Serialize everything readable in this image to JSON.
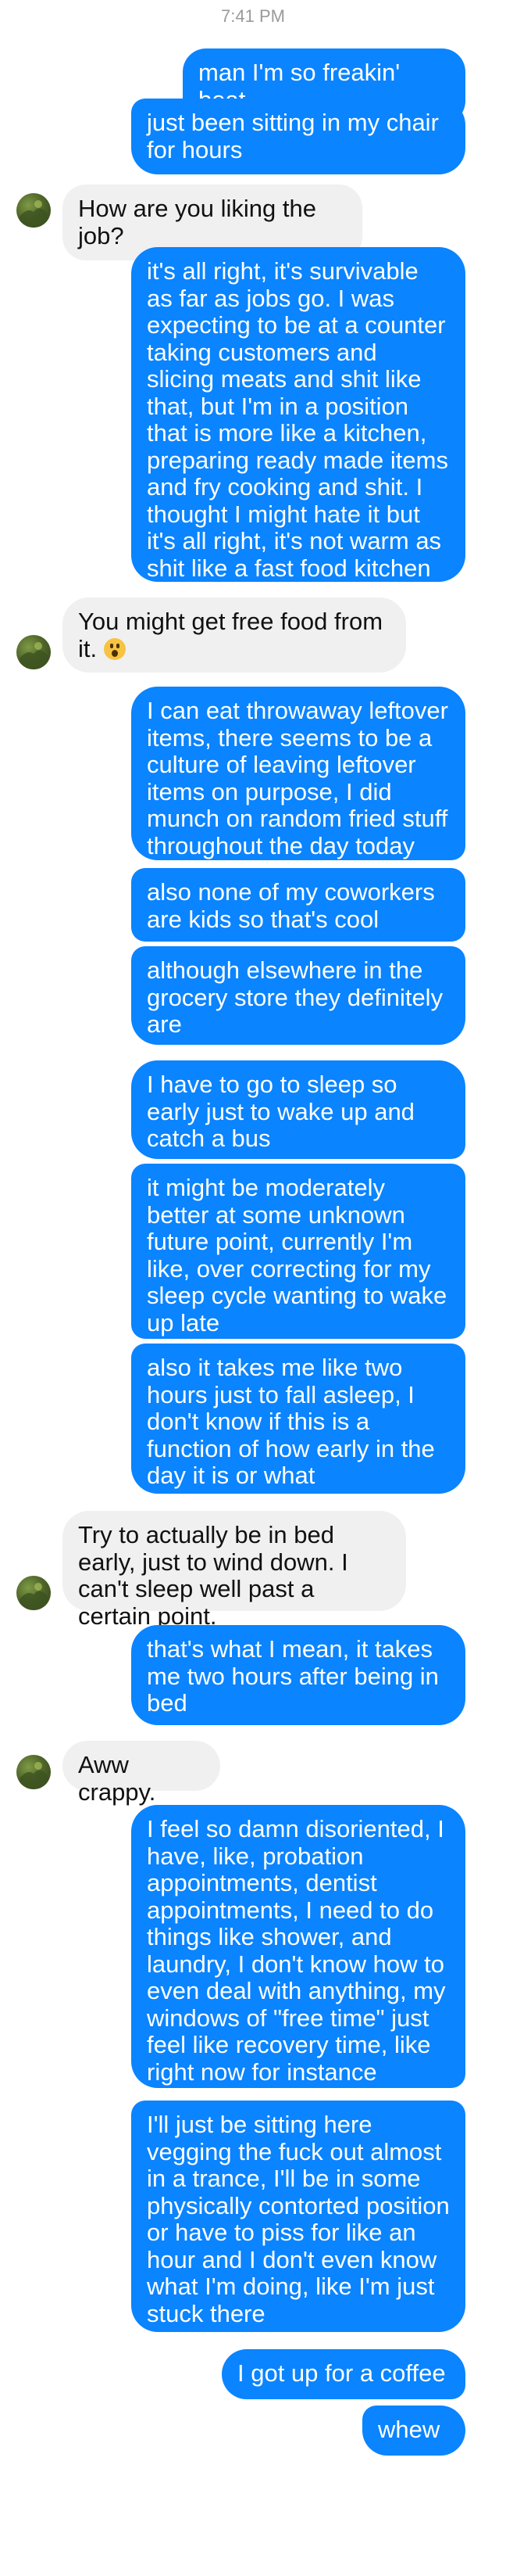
{
  "header": {
    "time": "7:41 PM"
  },
  "contact": {
    "avatar_icon": "contact-avatar-icon"
  },
  "colors": {
    "outgoing_bubble": "#0a84ff",
    "incoming_bubble": "#f0f0f0",
    "timestamp": "#9a9a9a"
  },
  "messages": [
    {
      "dir": "out",
      "text": "man I'm so freakin' beat"
    },
    {
      "dir": "out",
      "text": "just been sitting in my chair for hours"
    },
    {
      "dir": "in",
      "text": "How are you liking the job?"
    },
    {
      "dir": "out",
      "text": "it's all right, it's survivable as far as jobs go. I was expecting to be at a counter taking customers and slicing meats and shit like that, but I'm in a position that is more like a kitchen, preparing ready made items and fry cooking and shit. I thought I might hate it but it's all right, it's not warm as shit like a fast food kitchen"
    },
    {
      "dir": "in",
      "text": "You might get free food from it.",
      "emoji": "astonished-face-emoji"
    },
    {
      "dir": "out",
      "text": "I can eat throwaway leftover items, there seems to be a culture of leaving leftover items on purpose, I did munch on random fried stuff throughout the day today"
    },
    {
      "dir": "out",
      "text": "also none of my coworkers are kids so that's cool"
    },
    {
      "dir": "out",
      "text": "although elsewhere in the grocery store they definitely are"
    },
    {
      "dir": "out",
      "text": "I have to go to sleep so early just to wake up and catch a bus"
    },
    {
      "dir": "out",
      "text": "it might be moderately better at some unknown future point, currently I'm like, over correcting for my sleep cycle wanting to wake up late"
    },
    {
      "dir": "out",
      "text": "also it takes me like two hours just to fall asleep, I don't know if this is a function of how early in the day it is or what"
    },
    {
      "dir": "in",
      "text": "Try to actually be in bed early, just to wind down. I can't sleep well past a certain point."
    },
    {
      "dir": "out",
      "text": "that's what I mean, it takes me two hours after being in bed"
    },
    {
      "dir": "in",
      "text": "Aww crappy."
    },
    {
      "dir": "out",
      "text": "I feel so damn disoriented, I have, like, probation appointments, dentist appointments, I need to do things like shower, and laundry, I don't know how to even deal with anything, my windows of \"free time\" just feel like recovery time, like right now for instance"
    },
    {
      "dir": "out",
      "text": "I'll just be sitting here vegging the fuck out almost in a trance, I'll be in some physically contorted position or have to piss for like an hour and I don't even know what I'm doing, like I'm just stuck there"
    },
    {
      "dir": "out",
      "text": "I got up for a coffee"
    },
    {
      "dir": "out",
      "text": "whew"
    }
  ]
}
